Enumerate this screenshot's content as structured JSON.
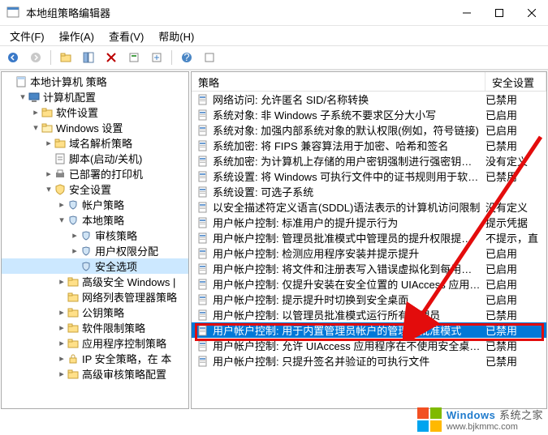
{
  "window": {
    "title": "本地组策略编辑器"
  },
  "menubar": [
    {
      "label": "文件(F)"
    },
    {
      "label": "操作(A)"
    },
    {
      "label": "查看(V)"
    },
    {
      "label": "帮助(H)"
    }
  ],
  "toolbar_icons": [
    "back-icon",
    "forward-icon",
    "up-icon",
    "properties-icon",
    "delete-icon",
    "refresh-icon",
    "export-icon",
    "help-icon",
    "filter-icon"
  ],
  "tree": [
    {
      "depth": 0,
      "toggle": "",
      "icon": "doc",
      "label": "本地计算机 策略"
    },
    {
      "depth": 1,
      "toggle": "▾",
      "icon": "computer",
      "label": "计算机配置"
    },
    {
      "depth": 2,
      "toggle": "▸",
      "icon": "folder",
      "label": "软件设置"
    },
    {
      "depth": 2,
      "toggle": "▾",
      "icon": "folder-open",
      "label": "Windows 设置"
    },
    {
      "depth": 3,
      "toggle": "▸",
      "icon": "folder",
      "label": "域名解析策略"
    },
    {
      "depth": 3,
      "toggle": "",
      "icon": "script",
      "label": "脚本(启动/关机)"
    },
    {
      "depth": 3,
      "toggle": "▸",
      "icon": "printer",
      "label": "已部署的打印机"
    },
    {
      "depth": 3,
      "toggle": "▾",
      "icon": "shield",
      "label": "安全设置"
    },
    {
      "depth": 4,
      "toggle": "▸",
      "icon": "shield-small",
      "label": "帐户策略"
    },
    {
      "depth": 4,
      "toggle": "▾",
      "icon": "shield-small",
      "label": "本地策略"
    },
    {
      "depth": 5,
      "toggle": "▸",
      "icon": "shield-small",
      "label": "审核策略"
    },
    {
      "depth": 5,
      "toggle": "▸",
      "icon": "shield-small",
      "label": "用户权限分配"
    },
    {
      "depth": 5,
      "toggle": "",
      "icon": "shield-small",
      "label": "安全选项",
      "selected": true
    },
    {
      "depth": 4,
      "toggle": "▸",
      "icon": "folder",
      "label": "高级安全 Windows |"
    },
    {
      "depth": 4,
      "toggle": "",
      "icon": "folder",
      "label": "网络列表管理器策略"
    },
    {
      "depth": 4,
      "toggle": "▸",
      "icon": "folder",
      "label": "公钥策略"
    },
    {
      "depth": 4,
      "toggle": "▸",
      "icon": "folder",
      "label": "软件限制策略"
    },
    {
      "depth": 4,
      "toggle": "▸",
      "icon": "folder",
      "label": "应用程序控制策略"
    },
    {
      "depth": 4,
      "toggle": "▸",
      "icon": "lock",
      "label": "IP 安全策略，在 本"
    },
    {
      "depth": 4,
      "toggle": "▸",
      "icon": "folder",
      "label": "高级审核策略配置"
    }
  ],
  "list": {
    "columns": {
      "name": "策略",
      "setting": "安全设置"
    },
    "rows": [
      {
        "name": "网络访问: 允许匿名 SID/名称转换",
        "setting": "已禁用"
      },
      {
        "name": "系统对象: 非 Windows 子系统不要求区分大小写",
        "setting": "已启用"
      },
      {
        "name": "系统对象: 加强内部系统对象的默认权限(例如，符号链接)",
        "setting": "已启用"
      },
      {
        "name": "系统加密: 将 FIPS 兼容算法用于加密、哈希和签名",
        "setting": "已禁用"
      },
      {
        "name": "系统加密: 为计算机上存储的用户密钥强制进行强密钥保护",
        "setting": "没有定义"
      },
      {
        "name": "系统设置: 将 Windows 可执行文件中的证书规则用于软件...",
        "setting": "已禁用"
      },
      {
        "name": "系统设置: 可选子系统",
        "setting": ""
      },
      {
        "name": "以安全描述符定义语言(SDDL)语法表示的计算机访问限制",
        "setting": "没有定义"
      },
      {
        "name": "用户帐户控制: 标准用户的提升提示行为",
        "setting": "提示凭据"
      },
      {
        "name": "用户帐户控制: 管理员批准模式中管理员的提升权限提示的...",
        "setting": "不提示，直"
      },
      {
        "name": "用户帐户控制: 检测应用程序安装并提示提升",
        "setting": "已启用"
      },
      {
        "name": "用户帐户控制: 将文件和注册表写入错误虚拟化到每用户位置",
        "setting": "已启用"
      },
      {
        "name": "用户帐户控制: 仅提升安装在安全位置的 UIAccess 应用程序",
        "setting": "已启用"
      },
      {
        "name": "用户帐户控制: 提示提升时切换到安全桌面",
        "setting": "已启用"
      },
      {
        "name": "用户帐户控制: 以管理员批准模式运行所有管理员",
        "setting": "已禁用"
      },
      {
        "name": "用户帐户控制: 用于内置管理员帐户的管理员批准模式",
        "setting": "已禁用",
        "selected": true
      },
      {
        "name": "用户帐户控制: 允许 UIAccess 应用程序在不使用安全桌面...",
        "setting": "已禁用"
      },
      {
        "name": "用户帐户控制: 只提升签名并验证的可执行文件",
        "setting": "已禁用"
      }
    ]
  },
  "watermark": {
    "brand": "Windows",
    "sub": "系统之家",
    "url": "www.bjkmmc.com"
  }
}
